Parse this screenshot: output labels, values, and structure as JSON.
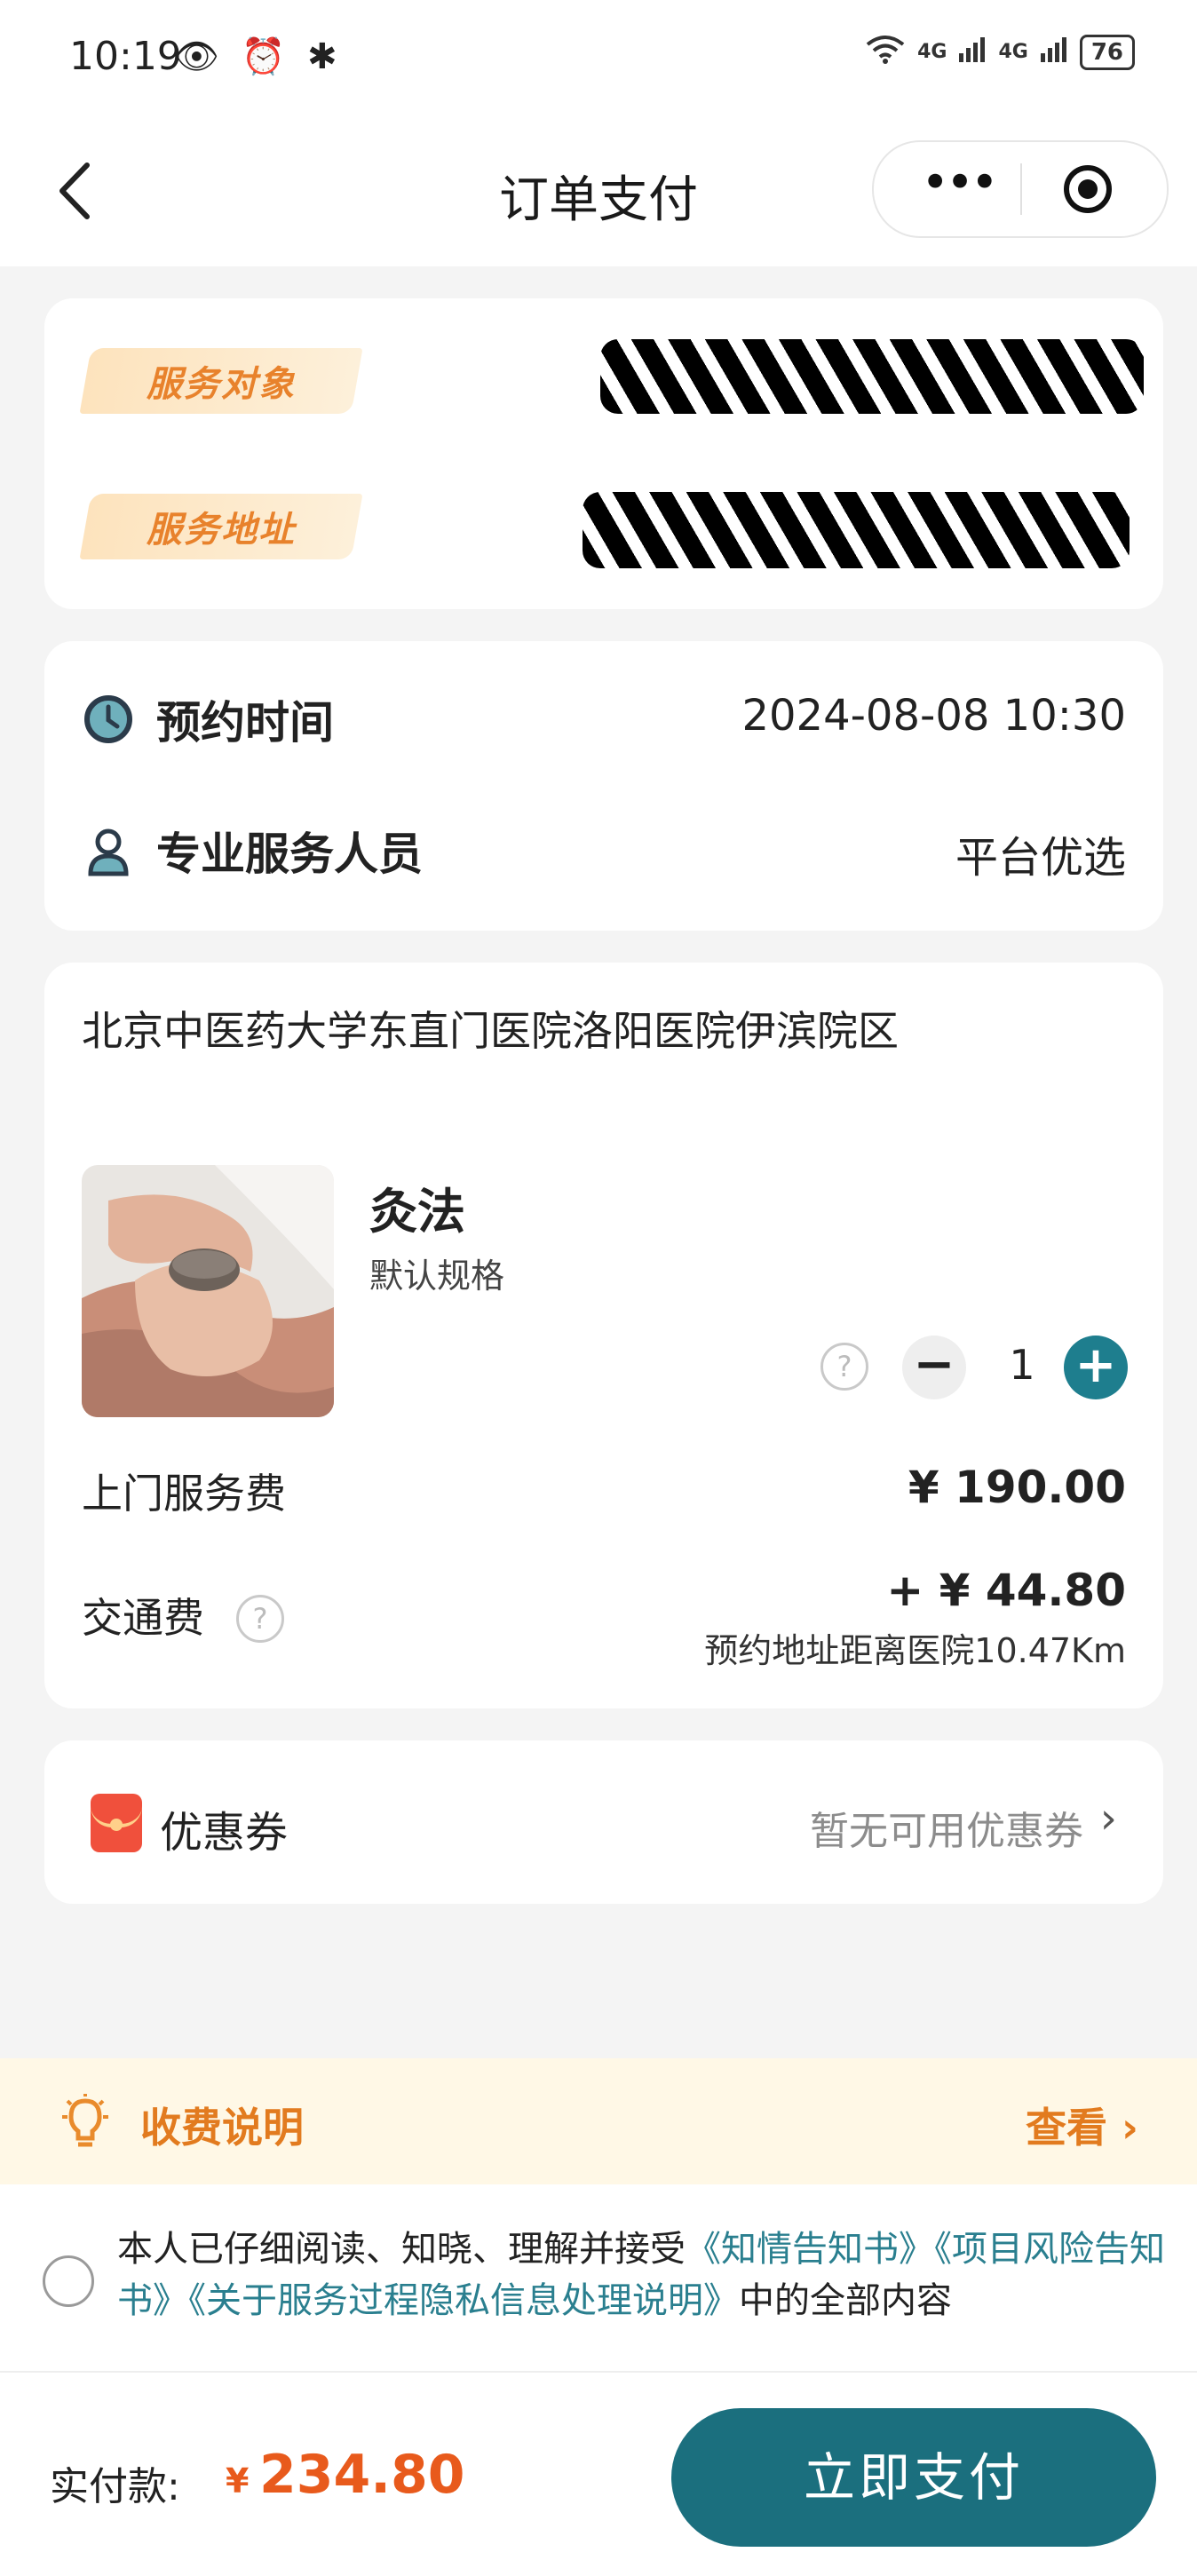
{
  "status_bar": {
    "time": "10:19",
    "left_icons": [
      "eye-icon",
      "alarm-icon",
      "bluetooth-icon"
    ],
    "signal_1": "4G",
    "signal_2": "4G",
    "battery": "76"
  },
  "nav": {
    "title": "订单支付",
    "more_label": "•••"
  },
  "recipient": {
    "subject_label": "服务对象",
    "address_label": "服务地址"
  },
  "appointment": {
    "time_label": "预约时间",
    "time_value": "2024-08-08 10:30",
    "staff_label": "专业服务人员",
    "staff_value": "平台优选"
  },
  "order": {
    "hospital": "北京中医药大学东直门医院洛阳医院伊滨院区",
    "service_name": "灸法",
    "service_spec": "默认规格",
    "quantity": "1",
    "help_symbol": "?",
    "service_fee_label": "上门服务费",
    "service_fee_value": "¥ 190.00",
    "transport_fee_label": "交通费",
    "transport_fee_value": "+ ¥ 44.80",
    "distance_note": "预约地址距离医院10.47Km"
  },
  "coupon": {
    "label": "优惠券",
    "value": "暂无可用优惠券",
    "chevron": "›"
  },
  "fee_explain": {
    "label": "收费说明",
    "view": "查看 ›"
  },
  "agreement": {
    "prefix": "本人已仔细阅读、知晓、理解并接受",
    "link1": "《知情告知书》",
    "link2": "《项目风险告知书》",
    "link3": "《关于服务过程隐私信息处理说明》",
    "suffix": "中的全部内容"
  },
  "payment": {
    "label": "实付款:",
    "currency": "¥",
    "amount": "234.80",
    "button": "立即支付"
  },
  "colors": {
    "accent": "#1b6f7e",
    "price": "#e85a1c",
    "tag_text": "#e8822c"
  }
}
